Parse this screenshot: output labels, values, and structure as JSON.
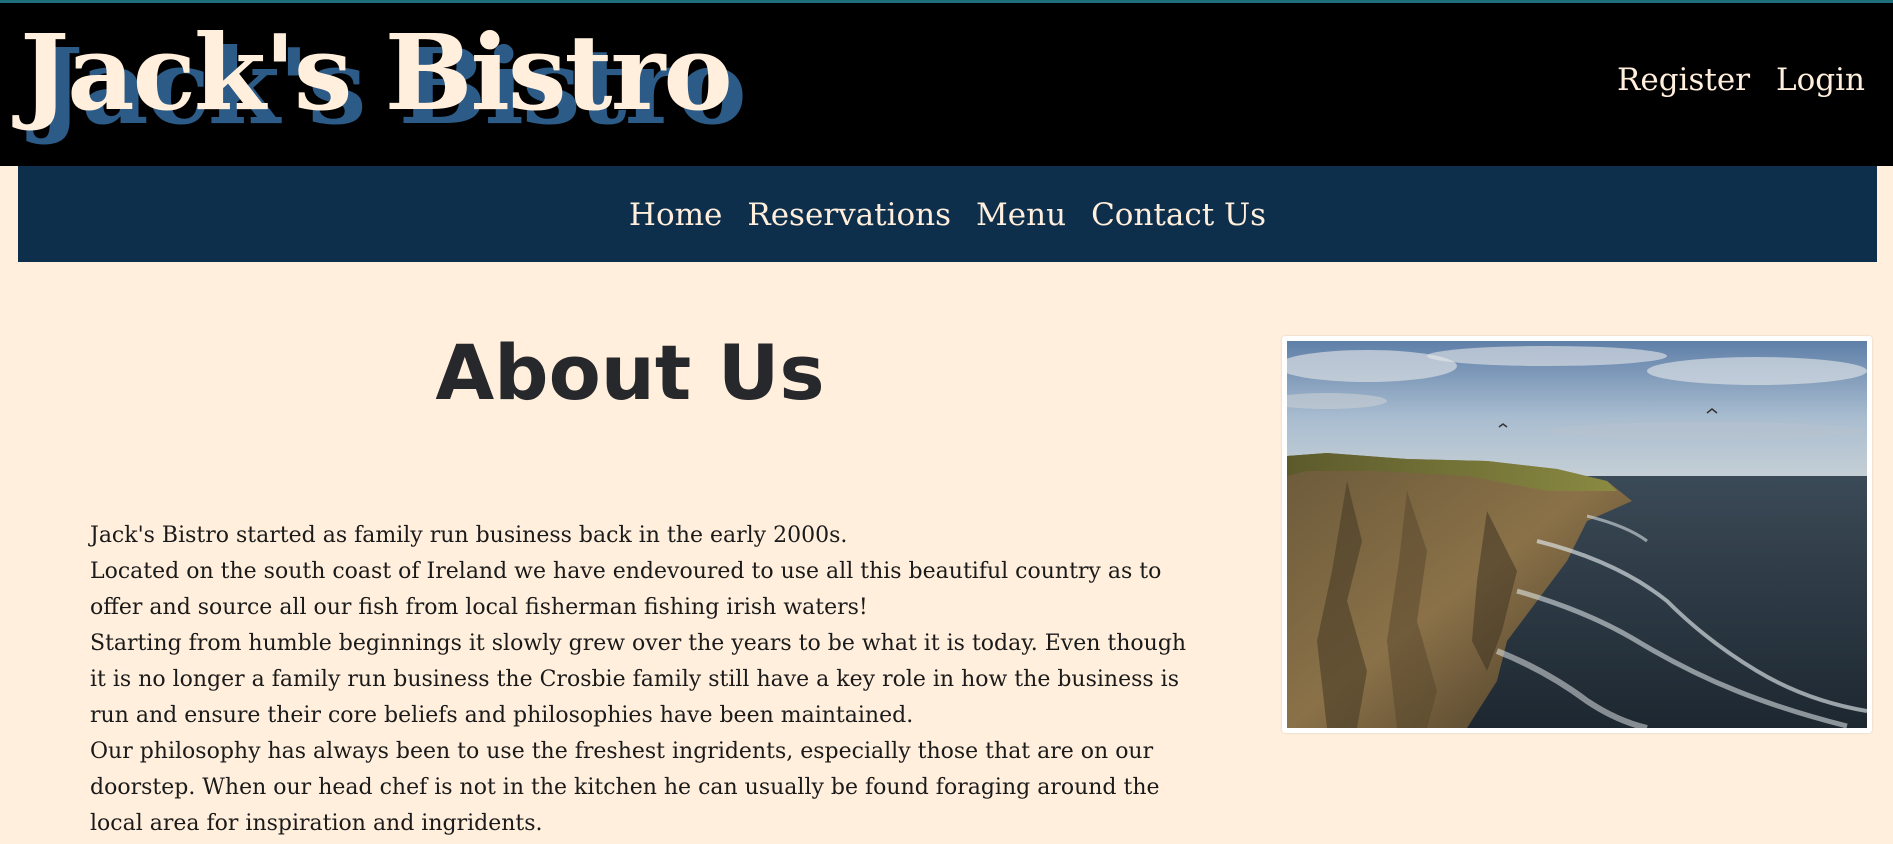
{
  "header": {
    "brand": "Jack's Bistro",
    "account_links": [
      "Register",
      "Login"
    ]
  },
  "nav": {
    "items": [
      "Home",
      "Reservations",
      "Menu",
      "Contact Us"
    ]
  },
  "main": {
    "title": "About Us",
    "paragraphs": [
      "Jack's Bistro started as family run business back in the early 2000s.",
      "Located on the south coast of Ireland we have endevoured to use all this beautiful country as to offer and source all our fish from local fisherman fishing irish waters!",
      "Starting from humble beginnings it slowly grew over the years to be what it is today. Even though it is no longer a family run business the Crosbie family still have a key role in how the business is run and ensure their core beliefs and philosophies have been maintained.",
      "Our philosophy has always been to use the freshest ingridents, especially those that are on our doorstep. When our head chef is not in the kitchen he can usually be found foraging around the local area for inspiration and ingridents."
    ]
  },
  "colors": {
    "page_background": "#ffefdc",
    "header_background": "#000000",
    "nav_background": "#0e2f4c",
    "brand_shadow": "#2b5b86",
    "text_light": "#ffefdc",
    "text_dark": "#27282c"
  }
}
